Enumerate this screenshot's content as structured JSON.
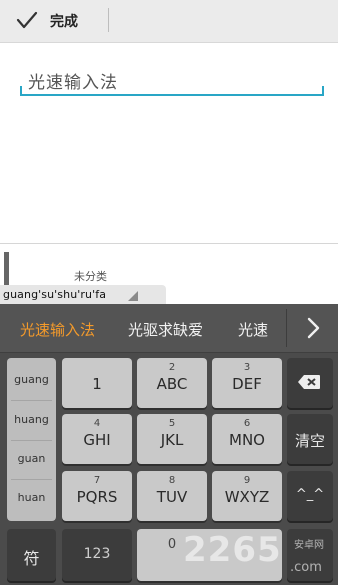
{
  "topbar": {
    "done_label": "完成",
    "check_icon": "checkmark-icon"
  },
  "editor": {
    "input_value": "光速输入法",
    "accent_color": "#29a6c6"
  },
  "category": {
    "label": "未分类"
  },
  "composing": {
    "pinyin": "guang'su'shu'ru'fa"
  },
  "keyboard": {
    "candidates": [
      {
        "text": "光速输入法",
        "highlight_color": "#f39a2b"
      },
      {
        "text": "光驱求缺爱"
      },
      {
        "text": "光速"
      }
    ],
    "more_icon": "chevron-right-icon",
    "syllables": [
      "guang",
      "huang",
      "guan",
      "huan"
    ],
    "keys": [
      {
        "num": "",
        "label": "1"
      },
      {
        "num": "2",
        "label": "ABC"
      },
      {
        "num": "3",
        "label": "DEF"
      },
      {
        "num": "4",
        "label": "GHI"
      },
      {
        "num": "5",
        "label": "JKL"
      },
      {
        "num": "6",
        "label": "MNO"
      },
      {
        "num": "7",
        "label": "PQRS"
      },
      {
        "num": "8",
        "label": "TUV"
      },
      {
        "num": "9",
        "label": "WXYZ"
      }
    ],
    "backspace_icon": "backspace-icon",
    "clear_label": "清空",
    "emoticon_label": "^_^",
    "symbol_label": "符",
    "num_label": "123",
    "space_num": "0"
  },
  "watermark": {
    "main": "2265",
    "sub1": "安卓网",
    "sub2": ".com"
  }
}
